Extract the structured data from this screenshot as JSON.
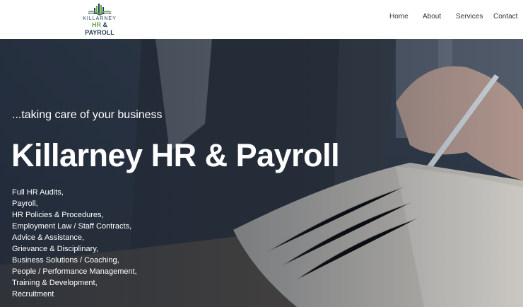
{
  "logo": {
    "line1": "KILLARNEY",
    "hr": "HR",
    "amp": " & ",
    "payroll": "PAYROLL"
  },
  "nav": {
    "items": [
      {
        "label": "Home"
      },
      {
        "label": "About"
      },
      {
        "label": "Services"
      },
      {
        "label": "Contact"
      }
    ]
  },
  "hero": {
    "tagline": "...taking care of your business",
    "title": "Killarney HR & Payroll",
    "services": [
      "Full HR Audits,",
      "Payroll,",
      "HR Policies & Procedures,",
      "Employment Law / Staff Contracts,",
      "Advice & Assistance,",
      "Grievance & Disciplinary,",
      "Business Solutions / Coaching,",
      "People / Performance Management,",
      "Training & Development,",
      "Recruitment"
    ]
  },
  "colors": {
    "brand_green": "#6aa84f",
    "brand_navy": "#1c3f57"
  }
}
